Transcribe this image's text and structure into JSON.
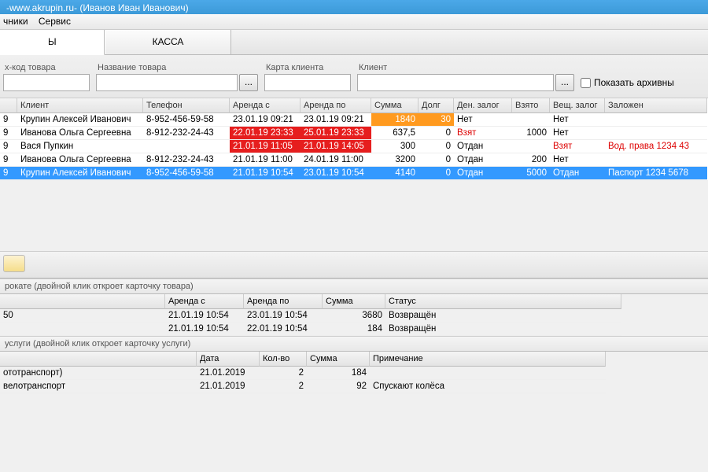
{
  "window": {
    "title": "-www.akrupin.ru- (Иванов Иван Иванович)"
  },
  "menu": [
    "чники",
    "Сервис"
  ],
  "tabs": {
    "orders": "Ы",
    "kassa": "КАССА"
  },
  "filters": {
    "barcode_label": "х-код товара",
    "name_label": "Название товара",
    "card_label": "Карта клиента",
    "client_label": "Клиент",
    "show_archive": "Показать архивны",
    "ellipsis": "..."
  },
  "grid1": {
    "cols": [
      "",
      "Клиент",
      "Телефон",
      "Аренда с",
      "Аренда по",
      "Сумма",
      "Долг",
      "Ден. залог",
      "Взято",
      "Вещ. залог",
      "Заложен"
    ],
    "rows": [
      {
        "n": "9",
        "client": "Крупин Алексей Иванович",
        "tel": "8-952-456-59-58",
        "from": "23.01.19 09:21",
        "to": "23.01.19 09:21",
        "sum": "1840",
        "dolg": "30",
        "den": "Нет",
        "vz": "",
        "ves": "Нет",
        "zal": "",
        "hl": {
          "sum": "orange",
          "dolg": "orange"
        }
      },
      {
        "n": "9",
        "client": "Иванова Ольга Сергеевна",
        "tel": "8-912-232-24-43",
        "from": "22.01.19 23:33",
        "to": "25.01.19 23:33",
        "sum": "637,5",
        "dolg": "0",
        "den": "Взят",
        "vz": "1000",
        "ves": "Нет",
        "zal": "",
        "hl": {
          "from": "red",
          "to": "red",
          "den": "txtred"
        }
      },
      {
        "n": "9",
        "client": "Вася Пупкин",
        "tel": "",
        "from": "21.01.19 11:05",
        "to": "21.01.19 14:05",
        "sum": "300",
        "dolg": "0",
        "den": "Отдан",
        "vz": "",
        "ves": "Взят",
        "zal": "Вод. права 1234 43",
        "hl": {
          "from": "red",
          "to": "red",
          "ves": "txtred",
          "zal": "txtred"
        }
      },
      {
        "n": "9",
        "client": "Иванова Ольга Сергеевна",
        "tel": "8-912-232-24-43",
        "from": "21.01.19 11:00",
        "to": "24.01.19 11:00",
        "sum": "3200",
        "dolg": "0",
        "den": "Отдан",
        "vz": "200",
        "ves": "Нет",
        "zal": "",
        "hl": {}
      },
      {
        "n": "9",
        "client": "Крупин Алексей Иванович",
        "tel": "8-952-456-59-58",
        "from": "21.01.19 10:54",
        "to": "23.01.19 10:54",
        "sum": "4140",
        "dolg": "0",
        "den": "Отдан",
        "vz": "5000",
        "ves": "Отдан",
        "zal": "Паспорт 1234 5678",
        "hl": {
          "row": "sel"
        }
      }
    ]
  },
  "section1": {
    "title": "рокате (двойной клик откроет карточку товара)",
    "cols": [
      "",
      "Аренда с",
      "Аренда по",
      "Сумма",
      "Статус"
    ],
    "rows": [
      {
        "name": "50",
        "from": "21.01.19 10:54",
        "to": "23.01.19 10:54",
        "sum": "3680",
        "status": "Возвращён"
      },
      {
        "name": "",
        "from": "21.01.19 10:54",
        "to": "22.01.19 10:54",
        "sum": "184",
        "status": "Возвращён"
      }
    ]
  },
  "section2": {
    "title": "услуги (двойной клик откроет карточку услуги)",
    "cols": [
      "",
      "Дата",
      "Кол-во",
      "Сумма",
      "Примечание"
    ],
    "rows": [
      {
        "name": "ототранспорт)",
        "date": "21.01.2019",
        "qty": "2",
        "sum": "184",
        "note": ""
      },
      {
        "name": "велотранспорт",
        "date": "21.01.2019",
        "qty": "2",
        "sum": "92",
        "note": "Спускают колёса"
      }
    ]
  }
}
